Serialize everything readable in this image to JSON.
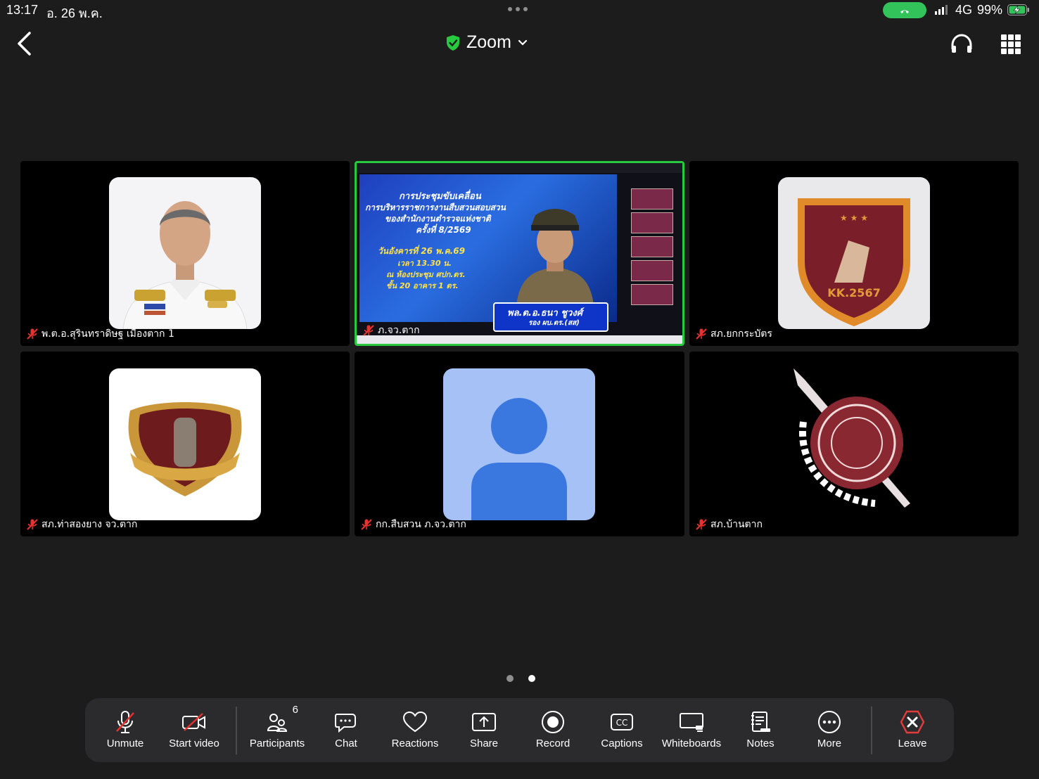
{
  "status_bar": {
    "time": "13:17",
    "date": "อ. 26 พ.ค.",
    "network": "4G",
    "battery": "99%",
    "battery_level": 0.99,
    "icons": [
      "call-active-icon",
      "signal-icon",
      "battery-charging-icon"
    ]
  },
  "header": {
    "title": "Zoom",
    "icons": [
      "back-chevron-icon",
      "shield-check-icon",
      "chevron-down-icon",
      "headphones-icon",
      "grid-apps-icon"
    ]
  },
  "participants": [
    {
      "name": "พ.ต.อ.สุรินทราดิษฐ  เมืองตาก 1",
      "muted": true,
      "avatar": "officer-portrait"
    },
    {
      "name": "ภ.จว.ตาก",
      "muted": true,
      "active_speaker": true,
      "sharing_screen": true
    },
    {
      "name": "สภ.ยกกระบัตร",
      "muted": true,
      "avatar": "badge-logo"
    },
    {
      "name": "สภ.ท่าสองยาง จว.ตาก",
      "muted": true,
      "avatar": "shield-logo"
    },
    {
      "name": "กก.สืบสวน ภ.จว.ตาก",
      "muted": true,
      "avatar": "default-user"
    },
    {
      "name": "สภ.บ้านตาก",
      "muted": true,
      "avatar": "seal-logo"
    }
  ],
  "shared_screen": {
    "headline_1": "การประชุมขับเคลื่อน",
    "headline_2": "การบริหารราชการงานสืบสวนสอบสวน",
    "headline_3": "ของสำนักงานตำรวจแห่งชาติ",
    "headline_4": "ครั้งที่ 8/2569",
    "date_line": "วันอังคารที่ 26 พ.ค.69",
    "time_line": "เวลา 13.30 น.",
    "place_line_1": "ณ ห้องประชุม ศปก.ตร.",
    "place_line_2": "ชั้น 20 อาคาร 1 ตร.",
    "speaker_name": "พล.ต.อ.ธนา  ชูวงศ์",
    "speaker_role": "รอง ผบ.ตร.(สส)"
  },
  "pager": {
    "pages": 2,
    "current": 2
  },
  "toolbar": {
    "unmute": "Unmute",
    "start_video": "Start video",
    "participants": "Participants",
    "participants_count": "6",
    "chat": "Chat",
    "reactions": "Reactions",
    "share": "Share",
    "record": "Record",
    "captions": "Captions",
    "whiteboards": "Whiteboards",
    "notes": "Notes",
    "more": "More",
    "leave": "Leave"
  },
  "colors": {
    "background": "#1c1c1c",
    "active_border": "#27c93f",
    "call_pill": "#32c35a",
    "muted_red": "#e8322f",
    "leave_red": "#e23b3b",
    "toolbar_bg": "#2b2b2d"
  }
}
